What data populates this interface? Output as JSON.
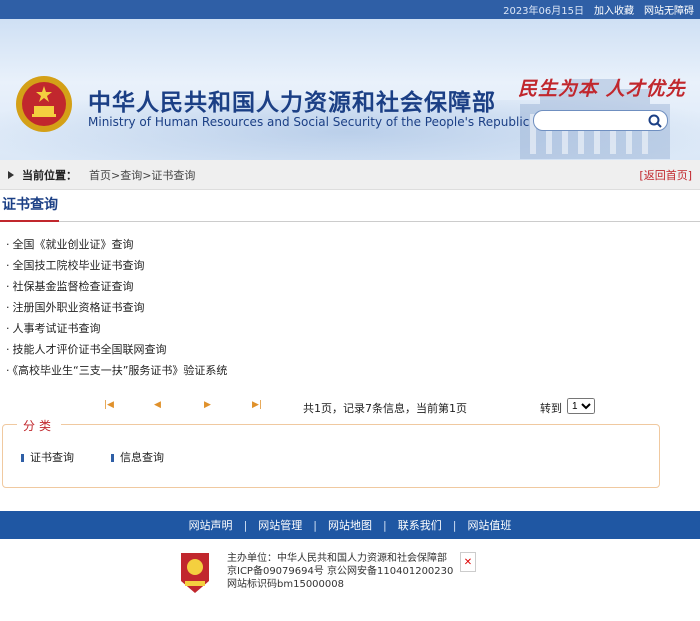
{
  "topbar": {
    "date": "2023年06月15日",
    "favorite": "加入收藏",
    "accessibility": "网站无障碍"
  },
  "header": {
    "title_cn": "中华人民共和国人力资源和社会保障部",
    "title_en": "Ministry of Human Resources and Social Security of the People's Republic of China",
    "slogan": "民生为本 人才优先",
    "search_placeholder": ""
  },
  "breadcrumb": {
    "label": "当前位置：",
    "path": "首页>查询>证书查询",
    "back": "[返回首页]"
  },
  "section": {
    "title": "证书查询"
  },
  "list": [
    "全国《就业创业证》查询",
    "全国技工院校毕业证书查询",
    "社保基金监督检查证查询",
    "注册国外职业资格证书查询",
    "人事考试证书查询",
    "技能人才评价证书全国联网查询",
    "《高校毕业生“三支一扶”服务证书》验证系统"
  ],
  "pager": {
    "info": "共1页，记录7条信息，当前第1页",
    "goto": "转到",
    "page": "1"
  },
  "category": {
    "legend": "分类",
    "items": [
      "证书查询",
      "信息查询"
    ]
  },
  "footer_nav": [
    "网站声明",
    "网站管理",
    "网站地图",
    "联系我们",
    "网站值班"
  ],
  "footer": {
    "sponsor": "主办单位：中华人民共和国人力资源和社会保障部",
    "icp": "京ICP备09079694号  京公网安备110401200230",
    "site_id": "网站标识码bm15000008"
  },
  "colors": {
    "primary": "#1f57a3",
    "accent": "#c1272d"
  }
}
